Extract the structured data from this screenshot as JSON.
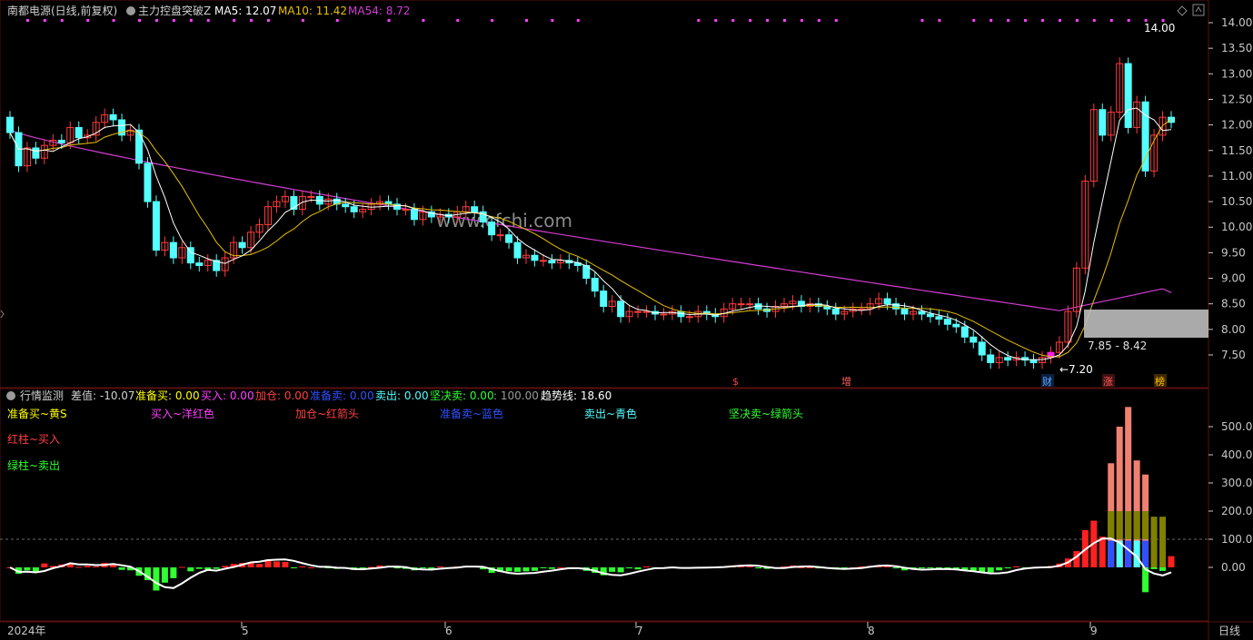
{
  "colors": {
    "up": "#ff3b3b",
    "down": "#54ffff",
    "ma5": "#ffffff",
    "ma10": "#e8c000",
    "ma54": "#d43cd4",
    "grid": "#5a1010",
    "axis_text": "#c8c8c8",
    "bg": "#000000",
    "dot_magenta": "#ff40ff"
  },
  "header": {
    "stock_name": "南都电源(日线,前复权)",
    "indicator_name": "主力控盘突破Z",
    "ma5": "MA5: 12.07",
    "ma10": "MA10: 11.42",
    "ma54": "MA54: 8.72"
  },
  "watermark": "www.cfchi.com",
  "price_axis": {
    "ticks": [
      "14.00",
      "13.50",
      "13.00",
      "12.50",
      "12.00",
      "11.50",
      "11.00",
      "10.50",
      "10.00",
      "9.50",
      "9.00",
      "8.50",
      "8.00",
      "7.50"
    ]
  },
  "annotations": {
    "high_label": "14.00",
    "low_label": "←7.20",
    "range_label": "7.85 - 8.42"
  },
  "event_markers": [
    {
      "label": "$",
      "color": "#ff4040"
    },
    {
      "label": "增",
      "color": "#ff6060"
    },
    {
      "label": "财",
      "color": "#5fa8ff"
    },
    {
      "label": "涨",
      "color": "#ff6060"
    },
    {
      "label": "榜",
      "color": "#ffc000"
    }
  ],
  "sub_header": {
    "name": "行情监测",
    "diff": "差值: -10.07",
    "prep_buy": "准备买: 0.00",
    "buy": "买入: 0.00",
    "add": "加仓: 0.00",
    "prep_sell": "准备卖: 0.00",
    "sell": "卖出: 0.00",
    "firm_sell": "坚决卖: 0.00",
    "hundred": ": 100.00",
    "trend": "趋势线: 18.60"
  },
  "legend": {
    "row1": [
      {
        "text": "准备买~黄S",
        "color": "#ffff00"
      },
      {
        "text": "买入~洋红色",
        "color": "#ff40ff"
      },
      {
        "text": "加仓~红箭头",
        "color": "#ff4040"
      },
      {
        "text": "准备卖~蓝色",
        "color": "#3050ff"
      },
      {
        "text": "卖出~青色",
        "color": "#54ffff"
      },
      {
        "text": "坚决卖~绿箭头",
        "color": "#30ff30"
      }
    ],
    "red_bar": "红柱~买入",
    "green_bar": "绿柱~卖出"
  },
  "sub_axis": {
    "ticks": [
      "500.00",
      "400.00",
      "300.00",
      "200.00",
      "100.00",
      "0.00"
    ]
  },
  "time_axis": {
    "year": "2024年",
    "months": [
      "5",
      "6",
      "7",
      "8",
      "9"
    ],
    "period": "日线"
  },
  "chart_data": {
    "type": "candlestick",
    "symbol": "南都电源",
    "price_range": [
      7.0,
      14.2
    ],
    "close_series": [
      11.85,
      11.2,
      11.55,
      11.35,
      11.6,
      11.7,
      11.65,
      11.95,
      11.75,
      11.8,
      12.05,
      12.2,
      12.1,
      11.8,
      11.9,
      11.25,
      10.5,
      9.55,
      9.7,
      9.4,
      9.6,
      9.3,
      9.25,
      9.35,
      9.15,
      9.4,
      9.7,
      9.6,
      9.9,
      10.05,
      10.4,
      10.5,
      10.6,
      10.35,
      10.6,
      10.6,
      10.45,
      10.55,
      10.45,
      10.4,
      10.3,
      10.35,
      10.45,
      10.5,
      10.45,
      10.35,
      10.35,
      10.15,
      10.3,
      10.2,
      10.25,
      10.2,
      10.3,
      10.4,
      10.3,
      10.1,
      9.85,
      9.85,
      9.7,
      9.4,
      9.45,
      9.35,
      9.35,
      9.3,
      9.35,
      9.3,
      9.25,
      9.0,
      8.75,
      8.45,
      8.55,
      8.25,
      8.35,
      8.35,
      8.35,
      8.3,
      8.3,
      8.35,
      8.25,
      8.25,
      8.35,
      8.3,
      8.25,
      8.4,
      8.5,
      8.5,
      8.5,
      8.4,
      8.35,
      8.45,
      8.5,
      8.55,
      8.45,
      8.5,
      8.45,
      8.4,
      8.3,
      8.35,
      8.4,
      8.4,
      8.5,
      8.6,
      8.5,
      8.4,
      8.3,
      8.35,
      8.3,
      8.25,
      8.2,
      8.1,
      8.05,
      7.85,
      7.75,
      7.5,
      7.35,
      7.45,
      7.4,
      7.45,
      7.4,
      7.35,
      7.45,
      7.55,
      7.75,
      8.35,
      9.2,
      10.9,
      12.3,
      11.8,
      12.25,
      13.2,
      11.95,
      12.45,
      11.1,
      11.8,
      12.15,
      12.05
    ],
    "ma54_end": 8.72,
    "high": 14.0,
    "low": 7.2,
    "range_box": [
      7.85,
      8.42
    ]
  }
}
